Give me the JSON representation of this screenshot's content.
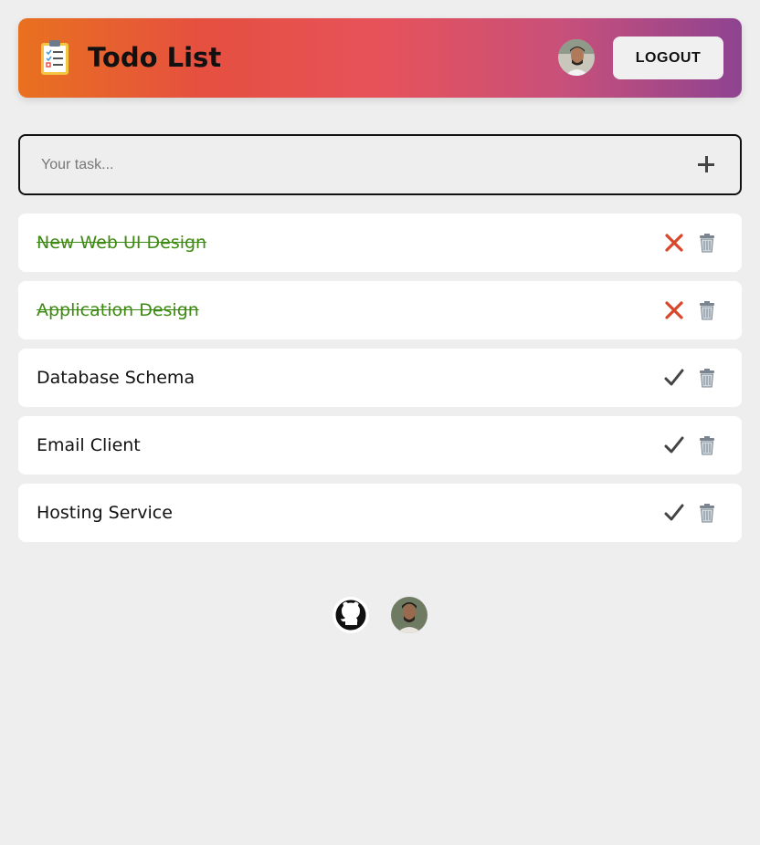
{
  "header": {
    "title": "Todo List",
    "logout_label": "LOGOUT",
    "logo_icon": "clipboard-checklist-icon",
    "gradient": [
      "#e8711f",
      "#e5503f",
      "#e6525a",
      "#c8507a",
      "#8e4391"
    ]
  },
  "task_input": {
    "placeholder": "Your task...",
    "value": "",
    "add_icon": "plus-icon"
  },
  "todos": [
    {
      "text": "New Web UI Design",
      "completed": true,
      "toggle_icon": "cross-mark-icon"
    },
    {
      "text": "Application Design",
      "completed": true,
      "toggle_icon": "cross-mark-icon"
    },
    {
      "text": "Database Schema",
      "completed": false,
      "toggle_icon": "check-mark-icon"
    },
    {
      "text": "Email Client",
      "completed": false,
      "toggle_icon": "check-mark-icon"
    },
    {
      "text": "Hosting Service",
      "completed": false,
      "toggle_icon": "check-mark-icon"
    }
  ],
  "colors": {
    "background": "#eeeeee",
    "completed_text": "#3d8a12",
    "cross": "#d9472b",
    "check": "#444444"
  },
  "footer": {
    "links": [
      "github-icon",
      "author-avatar"
    ]
  }
}
